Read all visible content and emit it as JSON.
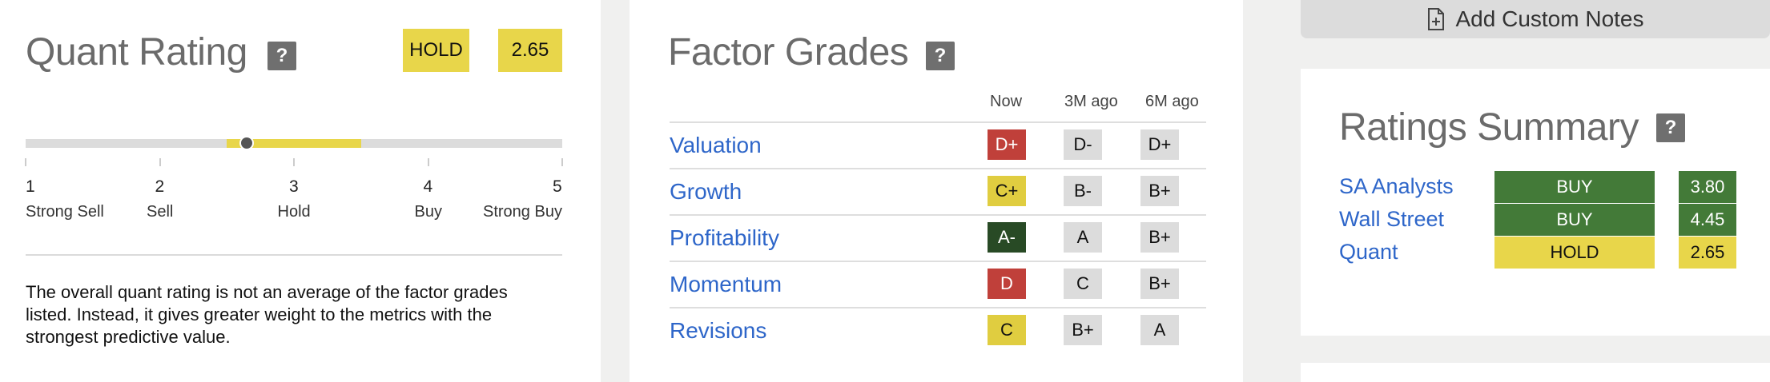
{
  "quant": {
    "title": "Quant Rating",
    "help": "?",
    "rating_label": "HOLD",
    "rating_value": "2.65",
    "rating_numeric": 2.65,
    "range_low": 2.5,
    "range_high": 3.5,
    "scale": [
      {
        "num": "1",
        "label": "Strong Sell"
      },
      {
        "num": "2",
        "label": "Sell"
      },
      {
        "num": "3",
        "label": "Hold"
      },
      {
        "num": "4",
        "label": "Buy"
      },
      {
        "num": "5",
        "label": "Strong Buy"
      }
    ],
    "description": "The overall quant rating is not an average of the factor grades listed. Instead, it gives greater weight to the metrics with the strongest predictive value."
  },
  "factor": {
    "title": "Factor Grades",
    "help": "?",
    "columns": [
      "Now",
      "3M ago",
      "6M ago"
    ],
    "rows": [
      {
        "label": "Valuation",
        "now": "D+",
        "m3": "D-",
        "m6": "D+",
        "now_color": "#c0403a"
      },
      {
        "label": "Growth",
        "now": "C+",
        "m3": "B-",
        "m6": "B+",
        "now_color": "#e0cd40"
      },
      {
        "label": "Profitability",
        "now": "A-",
        "m3": "A",
        "m6": "B+",
        "now_color": "#284a25"
      },
      {
        "label": "Momentum",
        "now": "D",
        "m3": "C",
        "m6": "B+",
        "now_color": "#c0403a"
      },
      {
        "label": "Revisions",
        "now": "C",
        "m3": "B+",
        "m6": "A",
        "now_color": "#e0cd40"
      }
    ]
  },
  "notes": {
    "label": "Add Custom Notes",
    "icon": "add-note-icon"
  },
  "summary": {
    "title": "Ratings Summary",
    "help": "?",
    "rows": [
      {
        "label": "SA Analysts",
        "rating": "BUY",
        "value": "3.80",
        "color": "#437a38"
      },
      {
        "label": "Wall Street",
        "rating": "BUY",
        "value": "4.45",
        "color": "#437a38"
      },
      {
        "label": "Quant",
        "rating": "HOLD",
        "value": "2.65",
        "color": "#e8d64a"
      }
    ]
  }
}
